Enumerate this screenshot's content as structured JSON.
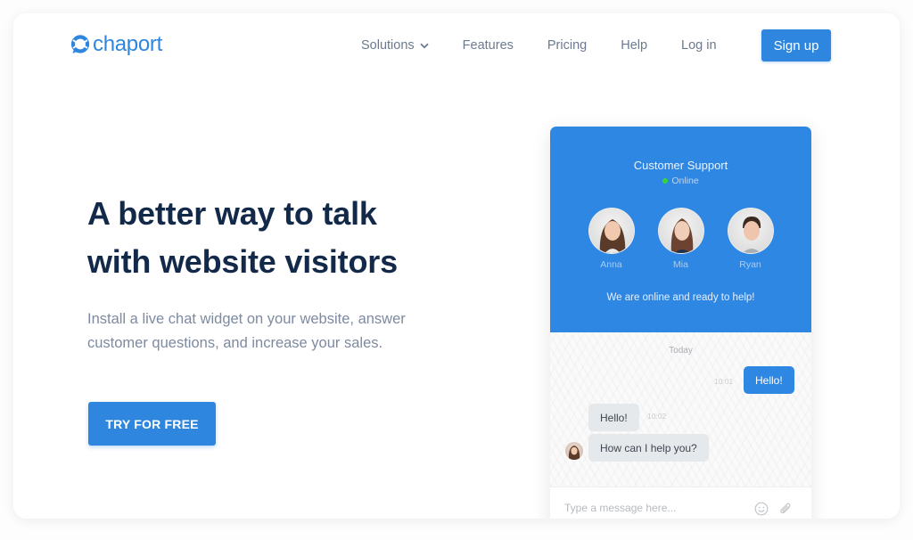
{
  "brand": {
    "name": "chaport",
    "color": "#2e86de"
  },
  "nav": {
    "items": [
      {
        "label": "Solutions",
        "has_dropdown": true
      },
      {
        "label": "Features"
      },
      {
        "label": "Pricing"
      },
      {
        "label": "Help"
      },
      {
        "label": "Log in"
      }
    ],
    "signup_label": "Sign up"
  },
  "hero": {
    "title_line1": "A better way to talk",
    "title_line2": "with website visitors",
    "subtitle": "Install a live chat widget on your website, answer customer questions, and increase your sales.",
    "cta_label": "TRY FOR FREE"
  },
  "widget": {
    "title": "Customer Support",
    "status": "Online",
    "agents": [
      {
        "name": "Anna"
      },
      {
        "name": "Mia"
      },
      {
        "name": "Ryan"
      }
    ],
    "tagline": "We are online and ready to help!",
    "day_label": "Today",
    "messages": [
      {
        "direction": "out",
        "text": "Hello!",
        "time": "10:01"
      },
      {
        "direction": "in",
        "text": "Hello!",
        "time": "10:02"
      },
      {
        "direction": "in",
        "text": "How can I help you?"
      }
    ],
    "input_placeholder": "Type a message here...",
    "icons": [
      "emoji-icon",
      "attachment-icon"
    ]
  },
  "colors": {
    "accent": "#2e86de",
    "widget_header": "#2f87e4",
    "heading": "#12294a",
    "body_text": "#7d8aa0",
    "online_dot": "#3ad33a"
  }
}
